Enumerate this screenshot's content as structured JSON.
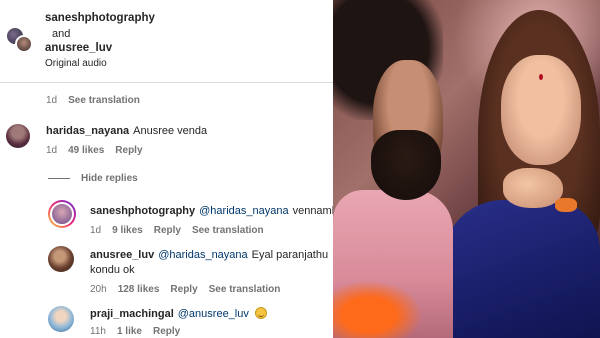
{
  "header": {
    "user1": "saneshphotography",
    "and_text": "and",
    "user2": "anusree_luv",
    "audio": "Original audio"
  },
  "comments": {
    "top": {
      "time": "1d",
      "see_translation": "See translation"
    },
    "haridas": {
      "user": "haridas_nayana",
      "text": "Anusree venda",
      "time": "1d",
      "likes": "49 likes",
      "reply": "Reply"
    },
    "hide_replies": "Hide replies",
    "replies": [
      {
        "user": "saneshphotography",
        "mention": "@haridas_nayana",
        "text": "vennamlo..",
        "time": "1d",
        "likes": "9 likes",
        "reply": "Reply",
        "see_translation": "See translation"
      },
      {
        "user": "anusree_luv",
        "mention": "@haridas_nayana",
        "text_line1": "Eyal paranjathu",
        "text_line2": "kondu ok",
        "time": "20h",
        "likes": "128 likes",
        "reply": "Reply",
        "see_translation": "See translation"
      },
      {
        "user": "praji_machingal",
        "mention": "@anusree_luv",
        "emoji": "grinning-face",
        "time": "11h",
        "likes": "1 like",
        "reply": "Reply"
      }
    ]
  }
}
